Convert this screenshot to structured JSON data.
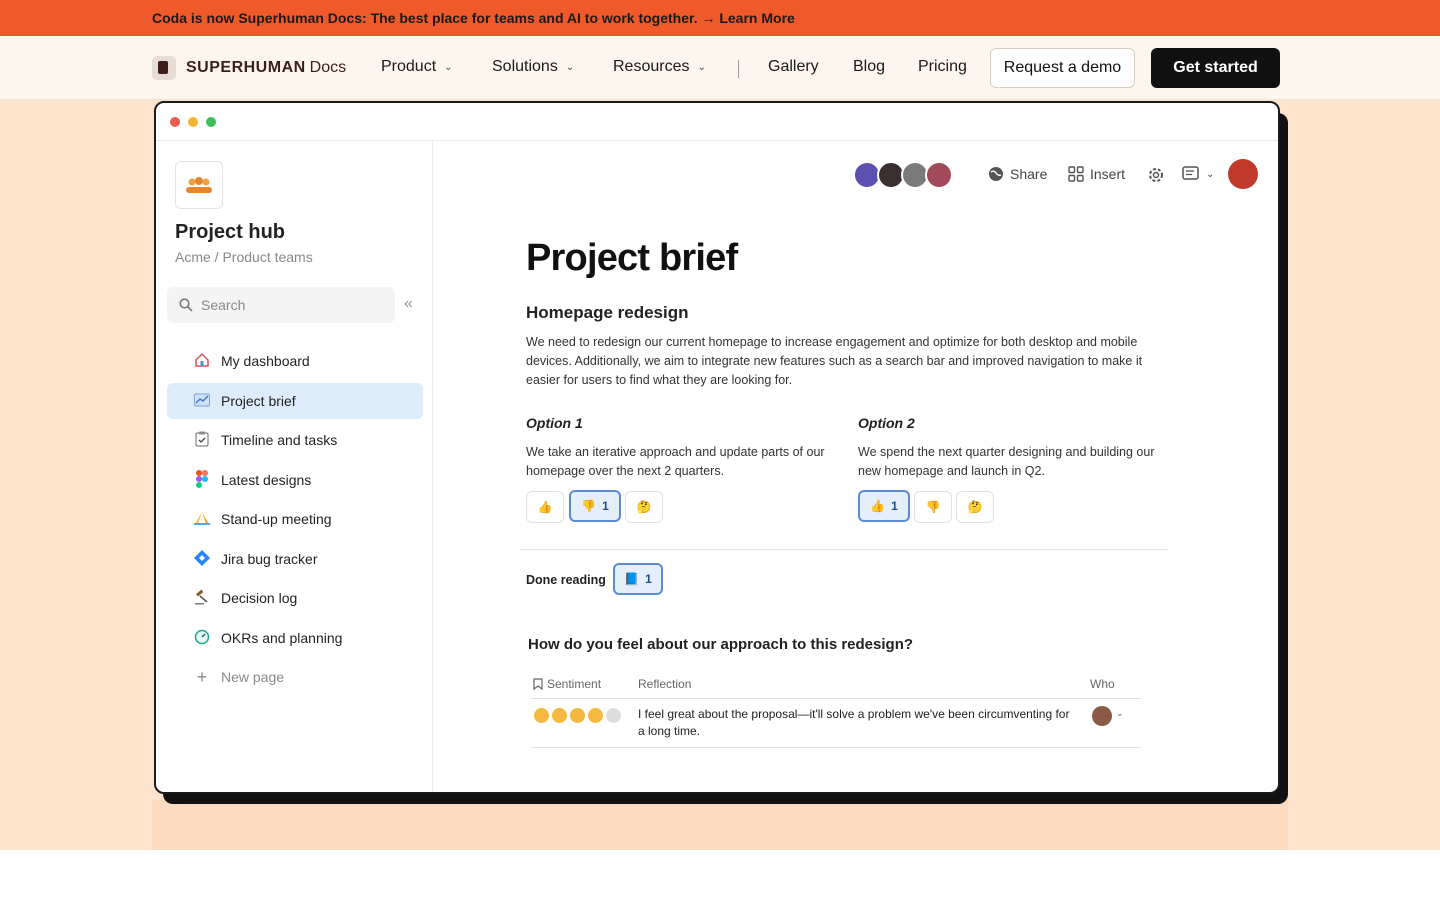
{
  "banner": {
    "text": "Coda is now Superhuman Docs: The best place for teams and AI to work together. → Learn More"
  },
  "nav": {
    "brand": "SUPERHUMAN",
    "brand_suffix": "Docs",
    "items": [
      {
        "label": "Product",
        "has_menu": true
      },
      {
        "label": "Solutions",
        "has_menu": true
      },
      {
        "label": "Resources",
        "has_menu": true
      },
      {
        "label": "Gallery",
        "has_menu": false
      },
      {
        "label": "Blog",
        "has_menu": false
      },
      {
        "label": "Pricing",
        "has_menu": false
      }
    ],
    "demo_label": "Request a demo",
    "start_label": "Get started"
  },
  "app": {
    "sidebar": {
      "title": "Project hub",
      "breadcrumb": "Acme / Product teams",
      "search_placeholder": "Search",
      "items": [
        {
          "label": "My dashboard",
          "icon": "house-icon"
        },
        {
          "label": "Project brief",
          "icon": "chart-icon",
          "active": true
        },
        {
          "label": "Timeline and tasks",
          "icon": "clipboard-icon"
        },
        {
          "label": "Latest designs",
          "icon": "figma-icon"
        },
        {
          "label": "Stand-up meeting",
          "icon": "hands-icon"
        },
        {
          "label": "Jira bug tracker",
          "icon": "jira-icon"
        },
        {
          "label": "Decision log",
          "icon": "gavel-icon"
        },
        {
          "label": "OKRs and planning",
          "icon": "gauge-icon"
        },
        {
          "label": "New page",
          "icon": "plus-icon"
        }
      ]
    },
    "toolbar": {
      "share": "Share",
      "insert": "Insert"
    },
    "doc": {
      "title": "Project brief",
      "section_title": "Homepage redesign",
      "section_body": "We need to redesign our current homepage to increase engagement and optimize for both desktop and mobile devices. Additionally, we aim to integrate new features such as a search bar and improved navigation to make it easier for users to find what they are looking for.",
      "option1_title": "Option 1",
      "option1_body": "We take an iterative approach and update parts of our homepage over the next 2 quarters.",
      "option1_thumbsdown_count": "1",
      "option2_title": "Option 2",
      "option2_body": "We spend the next quarter designing and building our new homepage and launch in Q2.",
      "option2_thumbsup_count": "1",
      "done_label": "Done reading",
      "done_count": "1",
      "question": "How do you feel about our approach to this redesign?",
      "table_headers": {
        "sentiment": "Sentiment",
        "reflection": "Reflection",
        "who": "Who"
      },
      "row_reflection": "I feel great about the proposal—it'll solve a problem we've been circumventing for a long time."
    }
  },
  "colors": {
    "banner": "#f05a2b",
    "hero": "#fde3cc",
    "active_item": "#dcecfa",
    "accent_blue": "#5b8bd0"
  }
}
